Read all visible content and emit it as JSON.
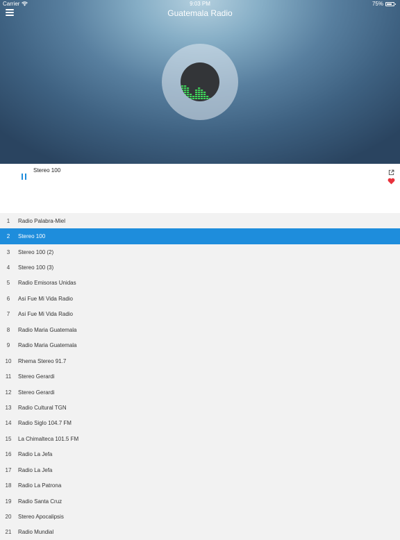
{
  "status_bar": {
    "carrier": "Carrier",
    "time": "9:03 PM",
    "battery": "75%",
    "battery_level": 0.75
  },
  "header": {
    "title": "Guatemala Radio"
  },
  "player": {
    "now_playing": "Stereo 100"
  },
  "stations": [
    {
      "num": "1",
      "name": "Radio Palabra-Miel"
    },
    {
      "num": "2",
      "name": "Stereo 100",
      "selected": true
    },
    {
      "num": "3",
      "name": "Stereo 100 (2)"
    },
    {
      "num": "4",
      "name": "Stereo 100 (3)"
    },
    {
      "num": "5",
      "name": "Radio Emisoras Unidas"
    },
    {
      "num": "6",
      "name": "Asi Fue Mi Vida Radio"
    },
    {
      "num": "7",
      "name": "Asi Fue Mi Vida Radio"
    },
    {
      "num": "8",
      "name": "Radio Maria Guatemala"
    },
    {
      "num": "9",
      "name": "Radio Maria Guatemala"
    },
    {
      "num": "10",
      "name": "Rhema Stereo 91.7"
    },
    {
      "num": "11",
      "name": "Stereo Gerardi"
    },
    {
      "num": "12",
      "name": "Stereo Gerardi"
    },
    {
      "num": "13",
      "name": "Radio Cultural TGN"
    },
    {
      "num": "14",
      "name": "Radio Siglo 104.7 FM"
    },
    {
      "num": "15",
      "name": "La Chimalteca 101.5 FM"
    },
    {
      "num": "16",
      "name": "Radio La Jefa"
    },
    {
      "num": "17",
      "name": "Radio La Jefa"
    },
    {
      "num": "18",
      "name": "Radio La Patrona"
    },
    {
      "num": "19",
      "name": "Radio Santa Cruz"
    },
    {
      "num": "20",
      "name": "Stereo Apocalipsis"
    },
    {
      "num": "21",
      "name": "Radio Mundial"
    }
  ],
  "colors": {
    "accent": "#1e8ddc",
    "heart": "#e8323c",
    "equalizer": "#3fd45a"
  }
}
